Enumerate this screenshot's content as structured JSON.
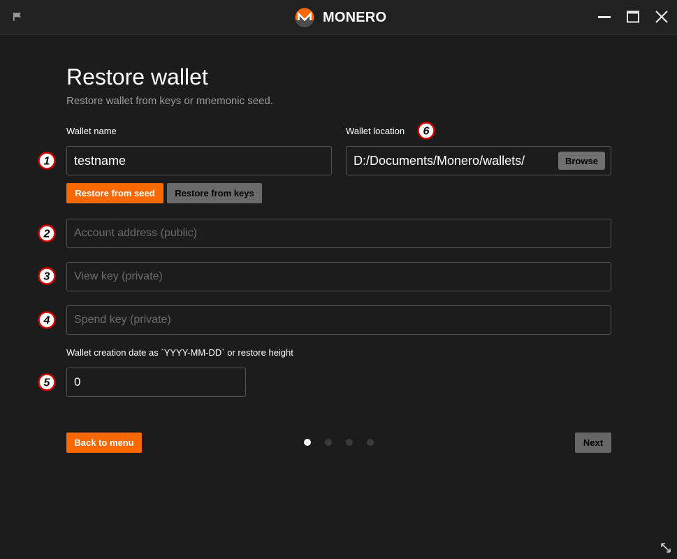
{
  "titlebar": {
    "brand": "MONERO",
    "icons": [
      "flag-icon",
      "monero-logo-icon",
      "minimize-icon",
      "maximize-icon",
      "close-icon"
    ]
  },
  "page": {
    "title": "Restore wallet",
    "subtitle": "Restore wallet from keys or mnemonic seed."
  },
  "form": {
    "wallet_name_label": "Wallet name",
    "wallet_name_value": "testname",
    "wallet_location_label": "Wallet location",
    "wallet_location_value": "D:/Documents/Monero/wallets/",
    "browse_label": "Browse",
    "restore_from_seed_label": "Restore from seed",
    "restore_from_keys_label": "Restore from keys",
    "account_address_placeholder": "Account address (public)",
    "view_key_placeholder": "View key (private)",
    "spend_key_placeholder": "Spend key (private)",
    "creation_date_label": "Wallet creation date as `YYYY-MM-DD` or restore height",
    "creation_date_value": "0"
  },
  "markers": [
    "1",
    "2",
    "3",
    "4",
    "5",
    "6"
  ],
  "footer": {
    "back_label": "Back to menu",
    "next_label": "Next",
    "pages_total": 4,
    "current_page": 1
  },
  "colors": {
    "accent": "#fa6800",
    "background": "#1c1c1c",
    "titlebar": "#212121",
    "input_border": "#545454",
    "marker_red": "#d40000"
  }
}
